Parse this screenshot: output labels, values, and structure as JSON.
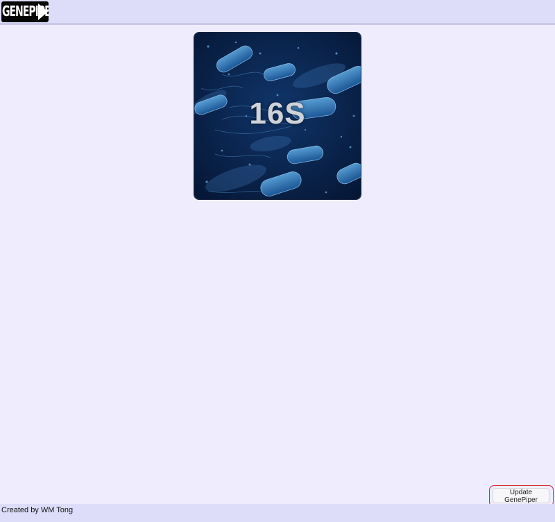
{
  "header": {
    "logo_text": "GENEPIPER"
  },
  "main": {
    "pipelines": [
      {
        "label": "16S"
      }
    ]
  },
  "actions": {
    "update_label": "Update GenePiper"
  },
  "footer": {
    "credit": "Created by WM Tong"
  },
  "colors": {
    "header_bg": "#dddcf9",
    "page_bg": "#efedfd",
    "highlight_border": "#d8263a"
  }
}
